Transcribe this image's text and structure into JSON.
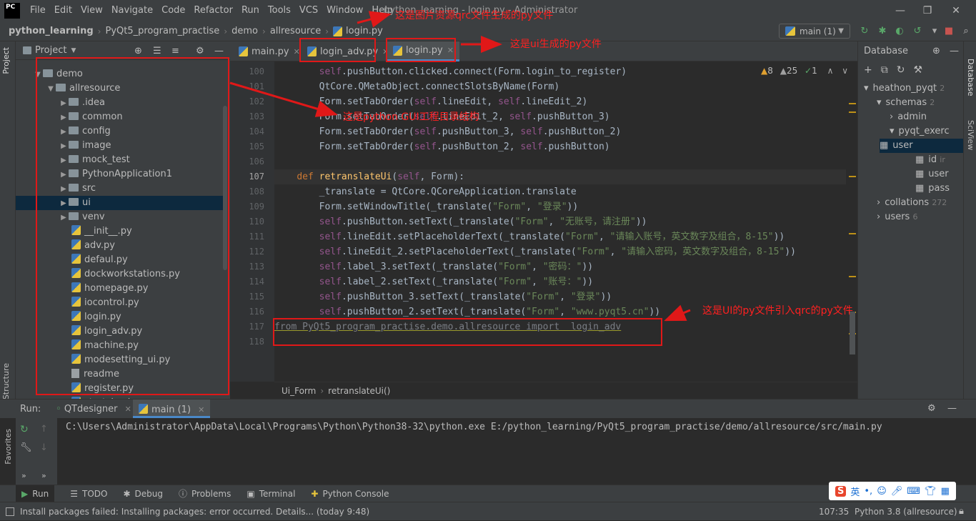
{
  "menubar": {
    "logo": "PC",
    "items": [
      "File",
      "Edit",
      "View",
      "Navigate",
      "Code",
      "Refactor",
      "Run",
      "Tools",
      "VCS",
      "Window",
      "Help"
    ],
    "title": "python_learning - login.py - Administrator"
  },
  "navbar": {
    "crumbs": [
      "python_learning",
      "PyQt5_program_practise",
      "demo",
      "allresource",
      "login.py"
    ],
    "branch": "main (1)"
  },
  "left_strip": {
    "project": "Project",
    "structure": "Structure",
    "favorites": "Favorites"
  },
  "project": {
    "header": "Project",
    "tree": [
      {
        "label": "demo",
        "type": "folder",
        "indent": 1,
        "expanded": true
      },
      {
        "label": "allresource",
        "type": "folder",
        "indent": 2,
        "expanded": true
      },
      {
        "label": ".idea",
        "type": "folder",
        "indent": 3
      },
      {
        "label": "common",
        "type": "folder",
        "indent": 3
      },
      {
        "label": "config",
        "type": "folder",
        "indent": 3
      },
      {
        "label": "image",
        "type": "folder",
        "indent": 3
      },
      {
        "label": "mock_test",
        "type": "folder",
        "indent": 3
      },
      {
        "label": "PythonApplication1",
        "type": "folder",
        "indent": 3
      },
      {
        "label": "src",
        "type": "folder",
        "indent": 3
      },
      {
        "label": "ui",
        "type": "folder",
        "indent": 3,
        "selected": true
      },
      {
        "label": "venv",
        "type": "folder",
        "indent": 3
      },
      {
        "label": "__init__.py",
        "type": "py",
        "indent": 4
      },
      {
        "label": "adv.py",
        "type": "py",
        "indent": 4
      },
      {
        "label": "defaul.py",
        "type": "py",
        "indent": 4
      },
      {
        "label": "dockworkstations.py",
        "type": "py",
        "indent": 4
      },
      {
        "label": "homepage.py",
        "type": "py",
        "indent": 4
      },
      {
        "label": "iocontrol.py",
        "type": "py",
        "indent": 4
      },
      {
        "label": "login.py",
        "type": "py",
        "indent": 4
      },
      {
        "label": "login_adv.py",
        "type": "py",
        "indent": 4
      },
      {
        "label": "machine.py",
        "type": "py",
        "indent": 4
      },
      {
        "label": "modesetting_ui.py",
        "type": "py",
        "indent": 4
      },
      {
        "label": "readme",
        "type": "txt",
        "indent": 4
      },
      {
        "label": "register.py",
        "type": "py",
        "indent": 4
      },
      {
        "label": "startcheck.py",
        "type": "py",
        "indent": 4
      }
    ]
  },
  "editor": {
    "tabs": [
      "main.py",
      "login_adv.py",
      "login.py"
    ],
    "active_tab": "login.py",
    "inspections": {
      "warnings": "8",
      "weak": "25",
      "typos": "1"
    },
    "line_numbers": [
      "100",
      "101",
      "102",
      "103",
      "104",
      "105",
      "106",
      "107",
      "108",
      "109",
      "110",
      "111",
      "112",
      "113",
      "114",
      "115",
      "116",
      "117",
      "118"
    ],
    "current_line": "107",
    "breadcrumb": [
      "Ui_Form",
      "retranslateUi()"
    ]
  },
  "database": {
    "header": "Database",
    "rows": [
      {
        "label": "heathon_pyqt",
        "extra": "2",
        "indent": 0
      },
      {
        "label": "schemas",
        "extra": "2",
        "indent": 1
      },
      {
        "label": "admin",
        "extra": "",
        "indent": 2
      },
      {
        "label": "pyqt_exerc",
        "extra": "",
        "indent": 2
      },
      {
        "label": "user",
        "extra": "",
        "indent": 3,
        "selected": true
      },
      {
        "label": "id",
        "extra": "ir",
        "indent": 4
      },
      {
        "label": "user",
        "extra": "",
        "indent": 4
      },
      {
        "label": "pass",
        "extra": "",
        "indent": 4
      },
      {
        "label": "collations",
        "extra": "272",
        "indent": 1
      },
      {
        "label": "users",
        "extra": "6",
        "indent": 1
      }
    ],
    "side_labels": {
      "database": "Database",
      "sciview": "SciView"
    }
  },
  "run": {
    "label": "Run:",
    "tabs": [
      "QTdesigner",
      "main (1)"
    ],
    "console": "C:\\Users\\Administrator\\AppData\\Local\\Programs\\Python\\Python38-32\\python.exe E:/python_learning/PyQt5_program_practise/demo/allresource/src/main.py"
  },
  "bottom_tabs": [
    "Run",
    "TODO",
    "Debug",
    "Problems",
    "Terminal",
    "Python Console"
  ],
  "status": {
    "message": "Install packages failed: Installing packages: error occurred. Details... (today 9:48)",
    "position": "107:35",
    "interpreter": "Python 3.8 (allresource)"
  },
  "ime": {
    "lang": "英"
  },
  "annotations": {
    "qrc": "这是图片资源qrc文件生成的py文件",
    "ui": "这是ui生成的py文件",
    "tree": "这是python GUI工程目录结构",
    "import": "这是UI的py文件引入qrc的py文件"
  },
  "colors": {
    "accent": "#4a88c7",
    "annotation": "#ff2020",
    "selection": "#0d293e"
  }
}
